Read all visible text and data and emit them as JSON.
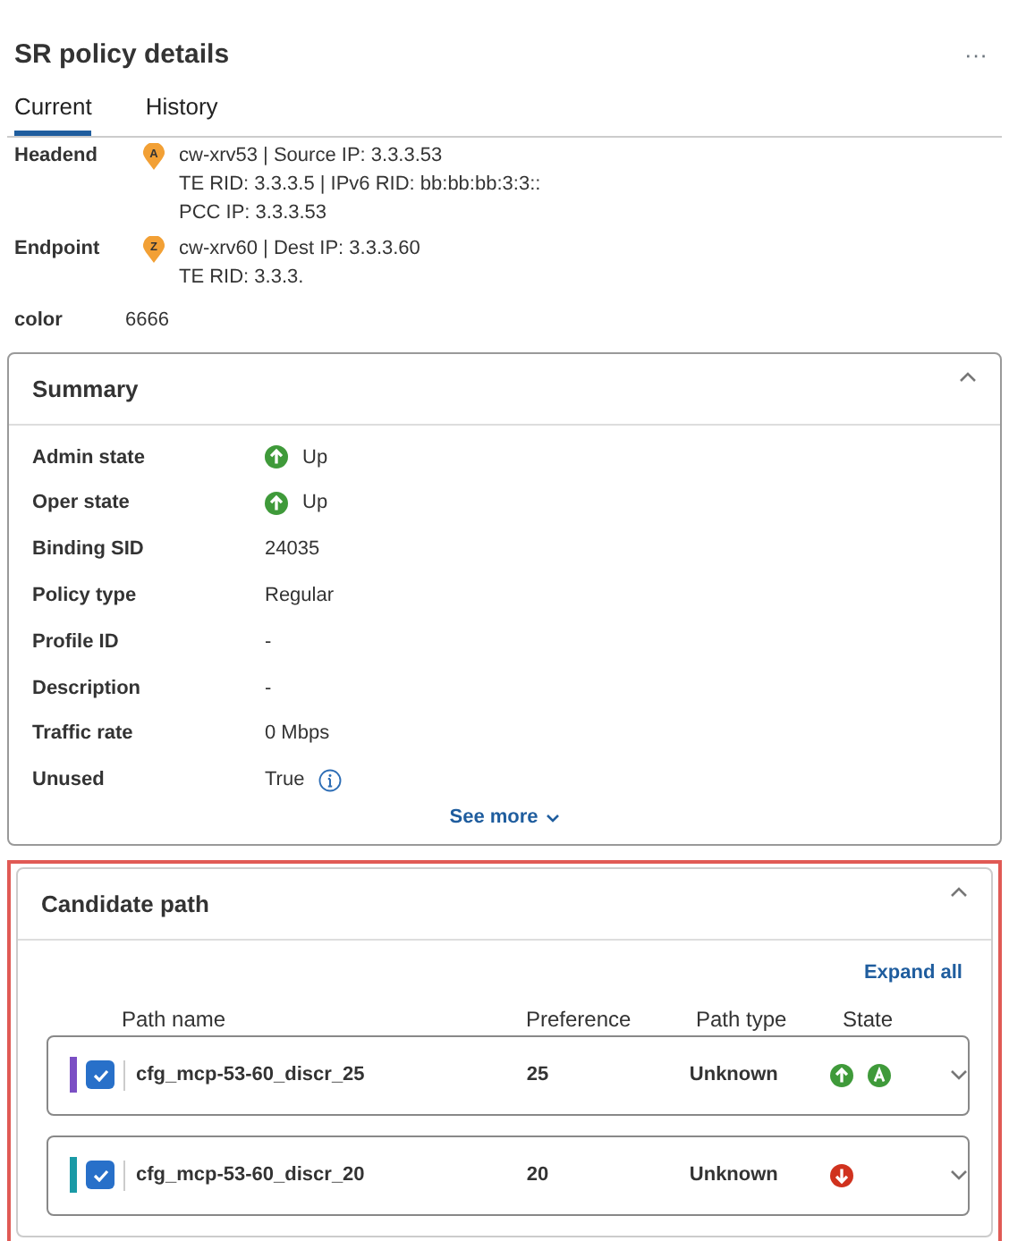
{
  "title": "SR policy details",
  "menu": "···",
  "tabs": [
    {
      "label": "Current",
      "selected": true
    },
    {
      "label": "History",
      "selected": false
    }
  ],
  "endpoints": [
    {
      "label": "Headend",
      "marker": "A",
      "lines": [
        "cw-xrv53 | Source IP: 3.3.3.53",
        "TE RID: 3.3.3.5 | IPv6 RID: bb:bb:bb:3:3::",
        "PCC IP: 3.3.3.53"
      ]
    },
    {
      "label": "Endpoint",
      "marker": "Z",
      "lines": [
        "cw-xrv60 | Dest IP: 3.3.3.60",
        "TE RID: 3.3.3."
      ]
    }
  ],
  "color": {
    "label": "color",
    "value": "6666"
  },
  "summary": {
    "title": "Summary",
    "expanded": true,
    "rows": [
      {
        "label": "Admin state",
        "value": "Up",
        "kind": "up"
      },
      {
        "label": "Oper state",
        "value": "Up",
        "kind": "up"
      },
      {
        "label": "Binding SID",
        "value": "24035"
      },
      {
        "label": "Policy type",
        "value": "Regular"
      },
      {
        "label": "Profile ID",
        "value": "-"
      },
      {
        "label": "Description",
        "value": "-"
      },
      {
        "label": "Traffic rate",
        "value": "0 Mbps"
      },
      {
        "label": "Unused",
        "value": "True",
        "kind": "info"
      }
    ],
    "see_more": "See more"
  },
  "candidate_path": {
    "title": "Candidate path",
    "expanded": true,
    "expand_all": "Expand all",
    "columns": [
      "Path name",
      "Preference",
      "Path type",
      "State"
    ],
    "rows": [
      {
        "color": "#7b4fc4",
        "checked": true,
        "name": "cfg_mcp-53-60_discr_25",
        "preference": "25",
        "path_type": "Unknown",
        "states": [
          {
            "kind": "up"
          },
          {
            "kind": "active"
          }
        ],
        "expanded": false
      },
      {
        "color": "#1a9aa6",
        "checked": true,
        "name": "cfg_mcp-53-60_discr_20",
        "preference": "20",
        "path_type": "Unknown",
        "states": [
          {
            "kind": "down"
          }
        ],
        "expanded": false
      }
    ]
  }
}
